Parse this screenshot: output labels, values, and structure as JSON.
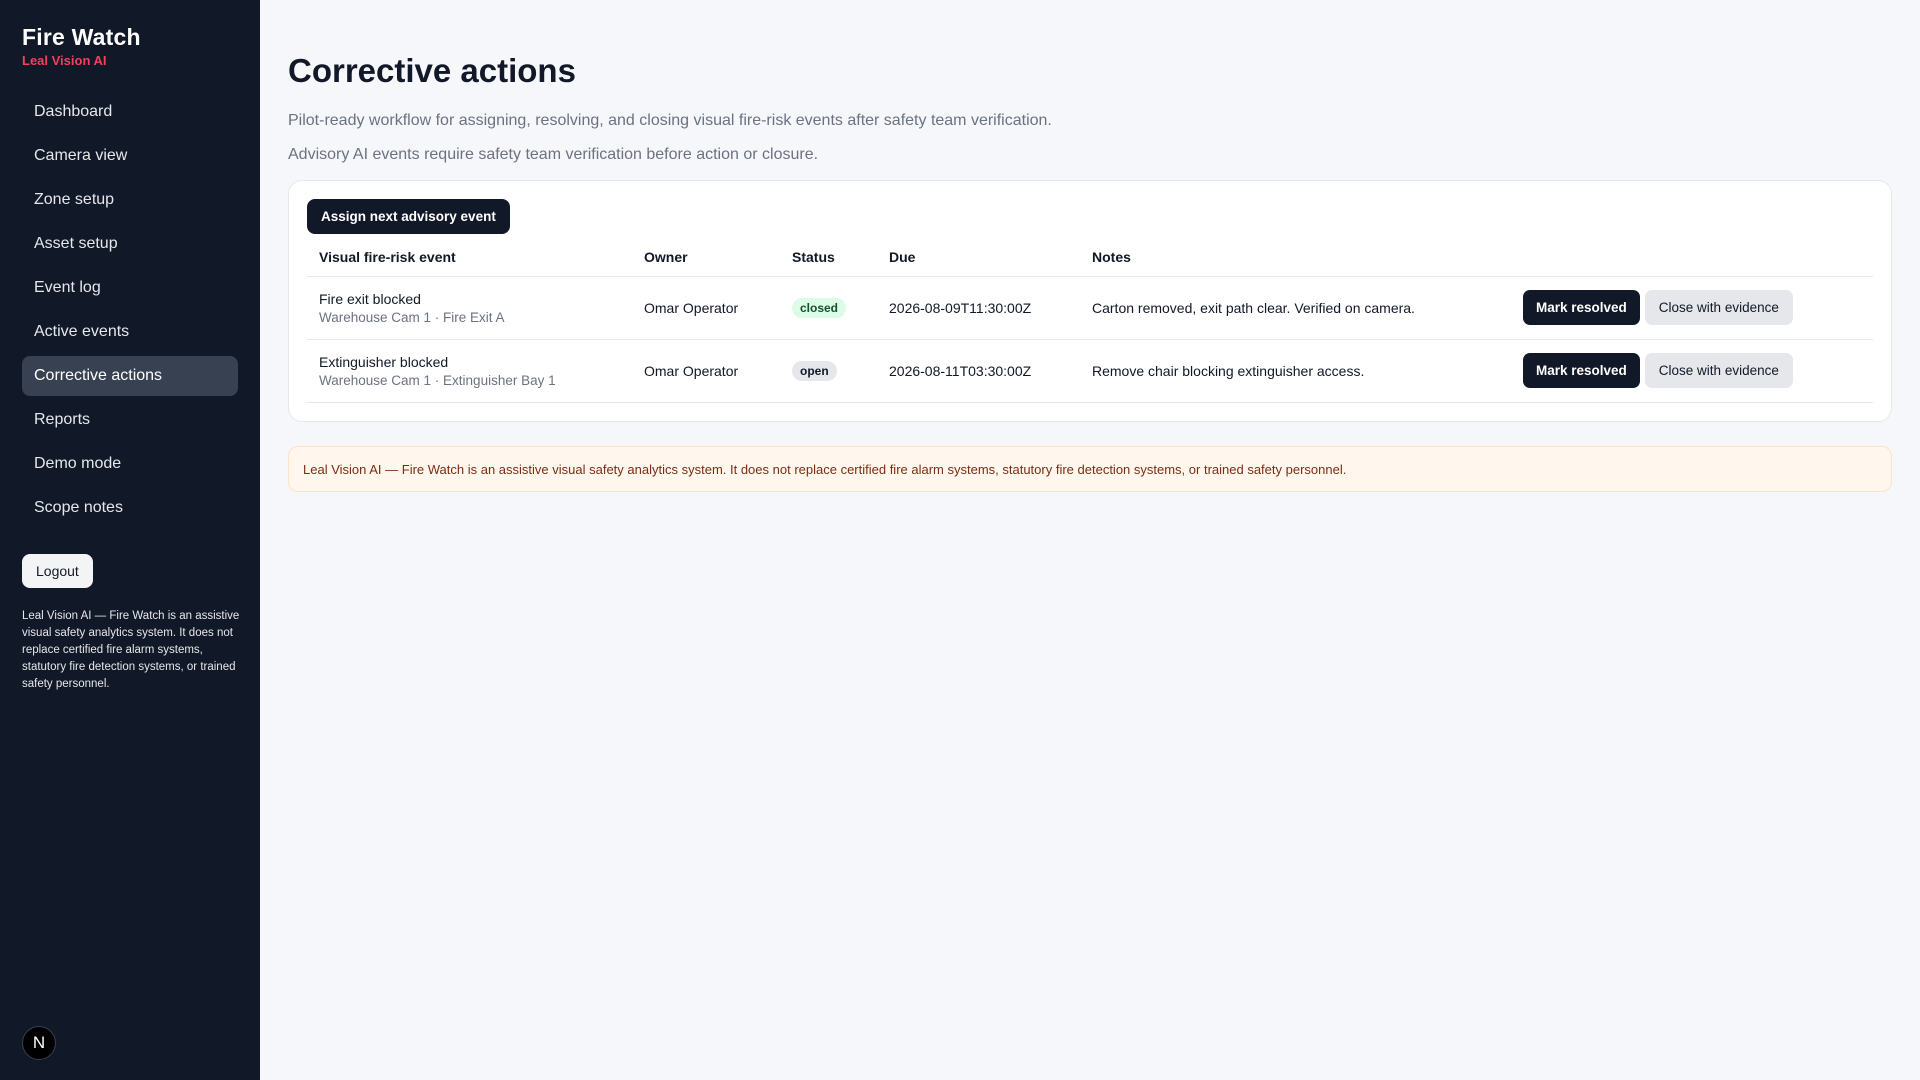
{
  "brand": {
    "title": "Fire Watch",
    "subtitle": "Leal Vision AI"
  },
  "sidebar": {
    "items": [
      {
        "label": "Dashboard"
      },
      {
        "label": "Camera view"
      },
      {
        "label": "Zone setup"
      },
      {
        "label": "Asset setup"
      },
      {
        "label": "Event log"
      },
      {
        "label": "Active events"
      },
      {
        "label": "Corrective actions",
        "active": true
      },
      {
        "label": "Reports"
      },
      {
        "label": "Demo mode"
      },
      {
        "label": "Scope notes"
      }
    ],
    "logout_label": "Logout",
    "disclaimer": "Leal Vision AI — Fire Watch is an assistive visual safety analytics system. It does not replace certified fire alarm systems, statutory fire detection systems, or trained safety personnel.",
    "badge_letter": "N"
  },
  "main": {
    "title": "Corrective actions",
    "subtitle": "Pilot-ready workflow for assigning, resolving, and closing visual fire-risk events after safety team verification.",
    "advisory_text": "Advisory AI events require safety team verification before action or closure.",
    "assign_button": "Assign next advisory event",
    "table": {
      "headers": [
        "Visual fire-risk event",
        "Owner",
        "Status",
        "Due",
        "Notes"
      ],
      "rows": [
        {
          "event": "Fire exit blocked",
          "location": "Warehouse Cam 1 · Fire Exit A",
          "owner": "Omar Operator",
          "status": "closed",
          "due": "2026-08-09T11:30:00Z",
          "notes": "Carton removed, exit path clear. Verified on camera.",
          "resolve_label": "Mark resolved",
          "close_label": "Close with evidence"
        },
        {
          "event": "Extinguisher blocked",
          "location": "Warehouse Cam 1 · Extinguisher Bay 1",
          "owner": "Omar Operator",
          "status": "open",
          "due": "2026-08-11T03:30:00Z",
          "notes": "Remove chair blocking extinguisher access.",
          "resolve_label": "Mark resolved",
          "close_label": "Close with evidence"
        }
      ]
    },
    "footer_disclaimer": "Leal Vision AI — Fire Watch is an assistive visual safety analytics system. It does not replace certified fire alarm systems, statutory fire detection systems, or trained safety personnel."
  },
  "colors": {
    "sidebar_bg": "#111827",
    "brand_accent": "#f43f5e",
    "status_closed": "#dcfce7",
    "status_open": "#e5e7eb",
    "warning_bg": "#fff7ed"
  }
}
